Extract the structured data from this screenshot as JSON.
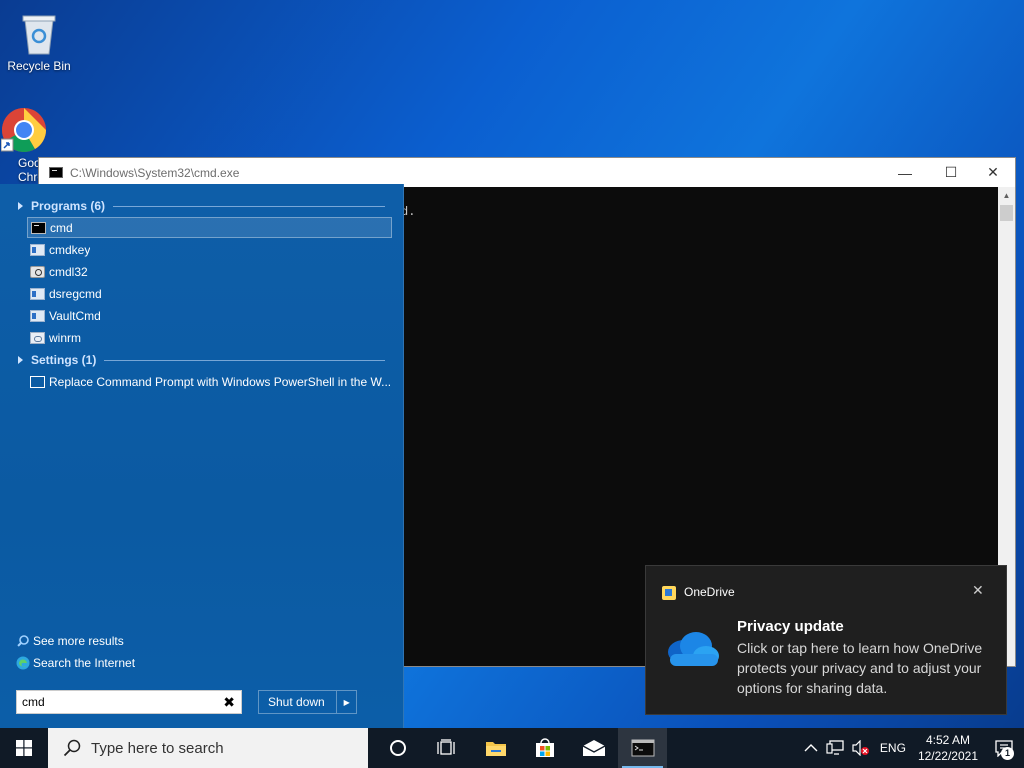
{
  "desktop": {
    "icons": [
      {
        "label": "Recycle Bin"
      },
      {
        "label": "Goo\nChro"
      }
    ]
  },
  "cmd_window": {
    "title": "C:\\Windows\\System32\\cmd.exe",
    "visible_text": "d.",
    "controls": {
      "minimize": "—",
      "maximize": "☐",
      "close": "✕"
    }
  },
  "start_menu": {
    "sections": [
      {
        "heading": "Programs (6)"
      },
      {
        "heading": "Settings (1)"
      }
    ],
    "programs": [
      {
        "label": "cmd",
        "icon": "cmd-icon"
      },
      {
        "label": "cmdkey",
        "icon": "app-icon"
      },
      {
        "label": "cmdl32",
        "icon": "gear-app-icon"
      },
      {
        "label": "dsregcmd",
        "icon": "app-icon"
      },
      {
        "label": "VaultCmd",
        "icon": "app-icon"
      },
      {
        "label": "winrm",
        "icon": "window-app-icon"
      }
    ],
    "settings": [
      {
        "label": "Replace Command Prompt with Windows PowerShell in the W...",
        "icon": "settings-icon"
      }
    ],
    "links": {
      "see_more": "See more results",
      "search_internet": "Search the Internet"
    },
    "search": {
      "value": "cmd",
      "clear": "✖"
    },
    "shutdown": {
      "label": "Shut down",
      "arrow": "▶"
    }
  },
  "toast": {
    "app": "OneDrive",
    "title": "Privacy update",
    "body": "Click or tap here to learn how OneDrive protects your privacy and to adjust your options for sharing data.",
    "close": "✕"
  },
  "taskbar": {
    "search_placeholder": "Type here to search",
    "tray": {
      "language": "ENG",
      "time": "4:52 AM",
      "date": "12/22/2021",
      "notification_count": "1"
    }
  },
  "colors": {
    "start_menu_bg": "#0e5ea8",
    "taskbar_bg": "#101a26",
    "toast_bg": "#1f1f1f",
    "accent": "#76b9ed"
  }
}
